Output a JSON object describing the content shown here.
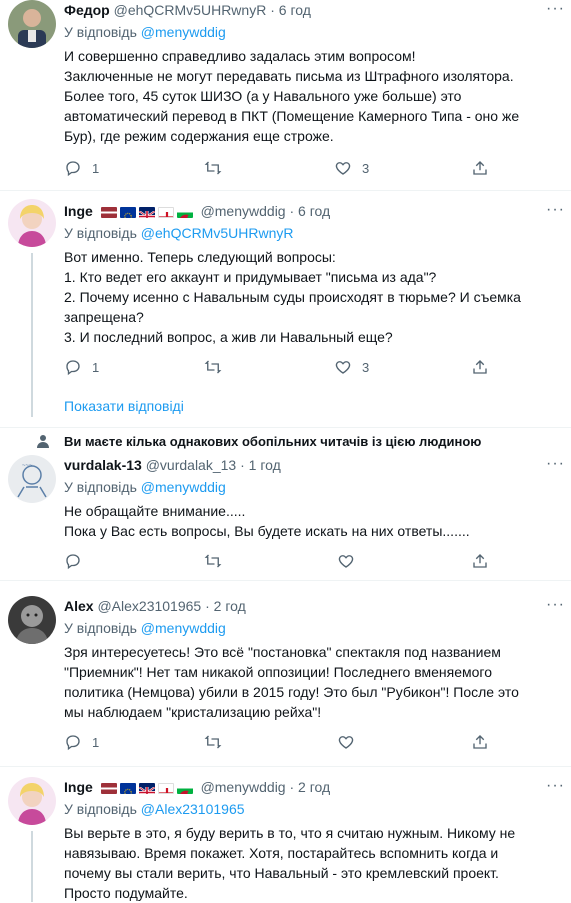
{
  "tweets": [
    {
      "name": "Федор",
      "handle": "@ehQCRMv5UHRwnyR",
      "sep": "·",
      "time": "6 год",
      "reply_prefix": "У відповідь",
      "reply_to": "@menywddig",
      "lines": [
        "И совершенно справедливо задалась этим вопросом!",
        "Заключенные не могут передавать письма из Штрафного изолятора.",
        "Более того, 45 суток ШИЗО (а у Навального уже больше) это",
        "автоматический перевод в ПКТ (Помещение Камерного Типа - оно же",
        "Бур), где режим содержания еще строже."
      ],
      "replies": "1",
      "retweets": "",
      "likes": "3"
    },
    {
      "name": "Inge",
      "handle": "@menywddig",
      "sep": "·",
      "time": "6 год",
      "reply_prefix": "У відповідь",
      "reply_to": "@ehQCRMv5UHRwnyR",
      "lines": [
        "Вот именно. Теперь следующий вопросы:",
        "1. Кто ведет его аккаунт и придумывает \"письма из ада\"?",
        "2. Почему исенно с Навальным суды происходят в тюрьме? И съемка",
        "запрещена?",
        "3. И последний вопрос, а жив ли Навальный еще?"
      ],
      "replies": "1",
      "retweets": "",
      "likes": "3"
    },
    {
      "name": "vurdalak-13",
      "handle": "@vurdalak_13",
      "sep": "·",
      "time": "1 год",
      "reply_prefix": "У відповідь",
      "reply_to": "@menywddig",
      "lines": [
        "Не обращайте внимание.....",
        "Пока у Вас есть вопросы, Вы будете искать на них ответы......."
      ],
      "replies": "",
      "retweets": "",
      "likes": ""
    },
    {
      "name": "Alex",
      "handle": "@Alex23101965",
      "sep": "·",
      "time": "2 год",
      "reply_prefix": "У відповідь",
      "reply_to": "@menywddig",
      "lines": [
        "Зря интересуетесь! Это всё \"постановка\" спектакля под названием",
        "\"Приемник\"! Нет там никакой оппозиции! Последнего вменяемого",
        "политика (Немцова) убили в 2015 году! Это был \"Рубикон\"! После это",
        "мы наблюдаем \"кристализацию рейха\"!"
      ],
      "replies": "1",
      "retweets": "",
      "likes": ""
    },
    {
      "name": "Inge",
      "handle": "@menywddig",
      "sep": "·",
      "time": "2 год",
      "reply_prefix": "У відповідь",
      "reply_to": "@Alex23101965",
      "lines": [
        "Вы верьте в это, я буду верить в то, что я считаю нужным. Никому не",
        "навязываю. Время покажет. Хотя, постарайтесь вспомнить когда и",
        "почему вы стали верить, что Навальный - это кремлевский проект.",
        "Просто подумайте."
      ],
      "replies": "",
      "retweets": "",
      "likes": ""
    }
  ],
  "show_replies": "Показати відповіді",
  "follow_note": "Ви маєте кілька однакових обопільних читачів із цією людиною",
  "icons": {
    "reply": "reply-icon",
    "retweet": "retweet-icon",
    "like": "heart-icon",
    "share": "share-icon",
    "more": "more-icon",
    "person": "person-icon"
  },
  "flags": [
    "flag-latvia",
    "flag-eu",
    "flag-uk",
    "flag-england",
    "flag-wales"
  ],
  "colors": {
    "link": "#1d9bf0",
    "secondary": "#536471",
    "divider": "#eff3f4",
    "text": "#0f1419"
  }
}
